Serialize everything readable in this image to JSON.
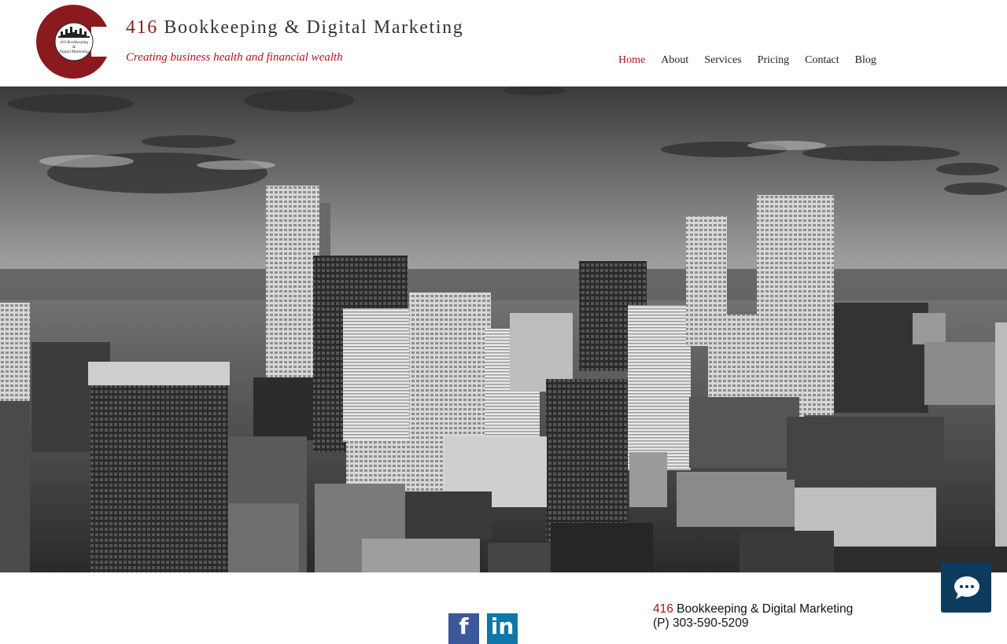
{
  "brand": {
    "title_number": "416",
    "title_rest": " Bookkeeping & Digital Marketing",
    "tagline": "Creating business health and financial wealth",
    "logo_text_line1": "416 Bookkeeping",
    "logo_text_line2": "&",
    "logo_text_line3": "Digital Marketing"
  },
  "nav": {
    "items": [
      "Home",
      "About",
      "Services",
      "Pricing",
      "Contact",
      "Blog"
    ],
    "active": "Home"
  },
  "hero": {
    "icon": "city-skyline-photo"
  },
  "footer": {
    "company_number": "416",
    "company_rest": " Bookkeeping & Digital Marketing",
    "phone": "(P) 303-590-5209",
    "social": {
      "facebook_glyph": "f",
      "linkedin_glyph": "in"
    }
  },
  "chat": {
    "icon": "chat-bubble-icon"
  },
  "colors": {
    "brand_red": "#b0121b",
    "logo_red": "#8b1a1f",
    "chat_blue": "#0c3b5e",
    "facebook_blue": "#3b5998",
    "linkedin_blue": "#0e76a8"
  }
}
